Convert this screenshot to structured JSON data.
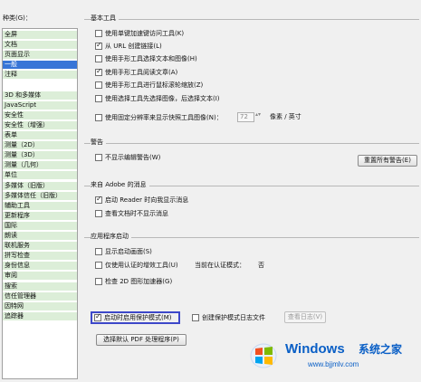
{
  "sidebar": {
    "label": "种类(G)：",
    "items": [
      {
        "label": "全屏",
        "state": "green"
      },
      {
        "label": "文档",
        "state": "green"
      },
      {
        "label": "页面显示",
        "state": "green"
      },
      {
        "label": "一般",
        "state": "selected"
      },
      {
        "label": "注释",
        "state": "green"
      },
      {
        "label": "",
        "state": "blank"
      },
      {
        "label": "3D 和多媒体",
        "state": "green"
      },
      {
        "label": "JavaScript",
        "state": "green"
      },
      {
        "label": "安全性",
        "state": "green"
      },
      {
        "label": "安全性（增强）",
        "state": "green"
      },
      {
        "label": "表单",
        "state": "green"
      },
      {
        "label": "测量（2D）",
        "state": "green"
      },
      {
        "label": "测量（3D）",
        "state": "green"
      },
      {
        "label": "测量（几何）",
        "state": "green"
      },
      {
        "label": "单位",
        "state": "green"
      },
      {
        "label": "多媒体（旧版）",
        "state": "green"
      },
      {
        "label": "多媒体信任（旧版）",
        "state": "green"
      },
      {
        "label": "辅助工具",
        "state": "green"
      },
      {
        "label": "更新程序",
        "state": "green"
      },
      {
        "label": "国际",
        "state": "green"
      },
      {
        "label": "朗读",
        "state": "green"
      },
      {
        "label": "联机服务",
        "state": "green"
      },
      {
        "label": "拼写检查",
        "state": "green"
      },
      {
        "label": "身份信息",
        "state": "green"
      },
      {
        "label": "审阅",
        "state": "green"
      },
      {
        "label": "搜索",
        "state": "green"
      },
      {
        "label": "信任管理器",
        "state": "green"
      },
      {
        "label": "因特网",
        "state": "green"
      },
      {
        "label": "追踪器",
        "state": "green"
      }
    ]
  },
  "basic_tools": {
    "title": "基本工具",
    "options": [
      {
        "label": "使用单键加速键访问工具(K)",
        "checked": false
      },
      {
        "label": "从 URL 创建链接(L)",
        "checked": true
      },
      {
        "label": "使用手形工具选择文本和图像(H)",
        "checked": false
      },
      {
        "label": "使用手形工具阅读文章(A)",
        "checked": true
      },
      {
        "label": "使用手形工具进行鼠标滚轮缩放(Z)",
        "checked": false
      },
      {
        "label": "使用选择工具先选择图像，后选择文本(I)",
        "checked": false
      },
      {
        "label": "使用固定分辨率来显示快照工具图像(N)：",
        "checked": false
      }
    ],
    "resolution_value": "72",
    "resolution_unit": "像素 / 英寸"
  },
  "warnings": {
    "title": "警告",
    "option": {
      "label": "不显示编辑警告(W)",
      "checked": false
    },
    "reset_button": "重置所有警告(E)"
  },
  "adobe_messages": {
    "title": "来自 Adobe 的消息",
    "options": [
      {
        "label": "启动 Reader 时向我显示消息",
        "checked": true
      },
      {
        "label": "查看文档时不显示消息",
        "checked": false
      }
    ]
  },
  "startup": {
    "title": "应用程序启动",
    "options": [
      {
        "label": "显示启动画面(S)",
        "checked": false
      },
      {
        "label": "仅使用认证的增效工具(U)",
        "checked": false
      },
      {
        "label": "检查 2D 图形加速器(G)",
        "checked": false
      }
    ],
    "cert_mode_label": "当前在认证模式：",
    "cert_mode_value": "否",
    "protected_mode": {
      "label": "启动时启用保护模式(M)",
      "checked": true
    },
    "protected_log": {
      "label": "创建保护模式日志文件",
      "checked": false
    },
    "view_log_button": "查看日志(V)",
    "default_pdf_button": "选择默认 PDF 处理程序(P)"
  },
  "watermark": {
    "brand": "Windows",
    "brand_cn": "系统之家",
    "url": "www.bjjmlv.com"
  },
  "colors": {
    "selected": "#3875d7",
    "category_green": "#dceed8",
    "highlight_border": "#3d48c9",
    "watermark_blue": "#0a5fc6"
  }
}
